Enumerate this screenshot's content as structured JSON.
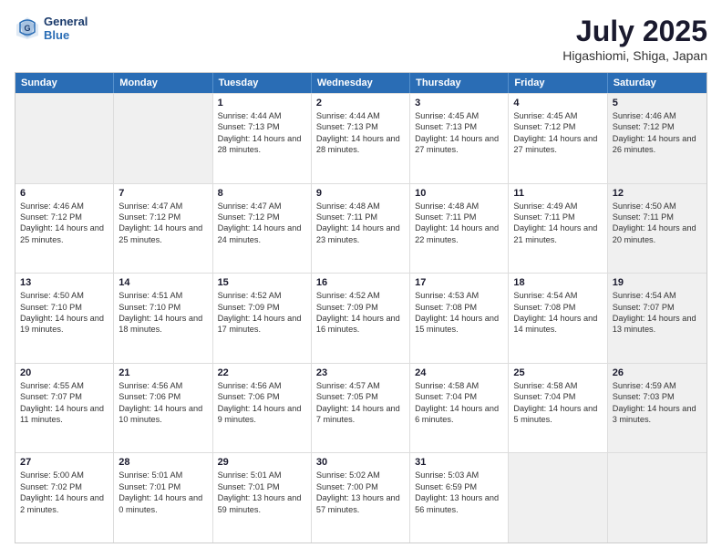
{
  "header": {
    "logo_line1": "General",
    "logo_line2": "Blue",
    "title": "July 2025",
    "subtitle": "Higashiomi, Shiga, Japan"
  },
  "days_of_week": [
    "Sunday",
    "Monday",
    "Tuesday",
    "Wednesday",
    "Thursday",
    "Friday",
    "Saturday"
  ],
  "weeks": [
    [
      {
        "day": "",
        "sunrise": "",
        "sunset": "",
        "daylight": "",
        "shaded": true
      },
      {
        "day": "",
        "sunrise": "",
        "sunset": "",
        "daylight": "",
        "shaded": true
      },
      {
        "day": "1",
        "sunrise": "Sunrise: 4:44 AM",
        "sunset": "Sunset: 7:13 PM",
        "daylight": "Daylight: 14 hours and 28 minutes."
      },
      {
        "day": "2",
        "sunrise": "Sunrise: 4:44 AM",
        "sunset": "Sunset: 7:13 PM",
        "daylight": "Daylight: 14 hours and 28 minutes."
      },
      {
        "day": "3",
        "sunrise": "Sunrise: 4:45 AM",
        "sunset": "Sunset: 7:13 PM",
        "daylight": "Daylight: 14 hours and 27 minutes."
      },
      {
        "day": "4",
        "sunrise": "Sunrise: 4:45 AM",
        "sunset": "Sunset: 7:12 PM",
        "daylight": "Daylight: 14 hours and 27 minutes."
      },
      {
        "day": "5",
        "sunrise": "Sunrise: 4:46 AM",
        "sunset": "Sunset: 7:12 PM",
        "daylight": "Daylight: 14 hours and 26 minutes.",
        "shaded": true
      }
    ],
    [
      {
        "day": "6",
        "sunrise": "Sunrise: 4:46 AM",
        "sunset": "Sunset: 7:12 PM",
        "daylight": "Daylight: 14 hours and 25 minutes."
      },
      {
        "day": "7",
        "sunrise": "Sunrise: 4:47 AM",
        "sunset": "Sunset: 7:12 PM",
        "daylight": "Daylight: 14 hours and 25 minutes."
      },
      {
        "day": "8",
        "sunrise": "Sunrise: 4:47 AM",
        "sunset": "Sunset: 7:12 PM",
        "daylight": "Daylight: 14 hours and 24 minutes."
      },
      {
        "day": "9",
        "sunrise": "Sunrise: 4:48 AM",
        "sunset": "Sunset: 7:11 PM",
        "daylight": "Daylight: 14 hours and 23 minutes."
      },
      {
        "day": "10",
        "sunrise": "Sunrise: 4:48 AM",
        "sunset": "Sunset: 7:11 PM",
        "daylight": "Daylight: 14 hours and 22 minutes."
      },
      {
        "day": "11",
        "sunrise": "Sunrise: 4:49 AM",
        "sunset": "Sunset: 7:11 PM",
        "daylight": "Daylight: 14 hours and 21 minutes."
      },
      {
        "day": "12",
        "sunrise": "Sunrise: 4:50 AM",
        "sunset": "Sunset: 7:11 PM",
        "daylight": "Daylight: 14 hours and 20 minutes.",
        "shaded": true
      }
    ],
    [
      {
        "day": "13",
        "sunrise": "Sunrise: 4:50 AM",
        "sunset": "Sunset: 7:10 PM",
        "daylight": "Daylight: 14 hours and 19 minutes."
      },
      {
        "day": "14",
        "sunrise": "Sunrise: 4:51 AM",
        "sunset": "Sunset: 7:10 PM",
        "daylight": "Daylight: 14 hours and 18 minutes."
      },
      {
        "day": "15",
        "sunrise": "Sunrise: 4:52 AM",
        "sunset": "Sunset: 7:09 PM",
        "daylight": "Daylight: 14 hours and 17 minutes."
      },
      {
        "day": "16",
        "sunrise": "Sunrise: 4:52 AM",
        "sunset": "Sunset: 7:09 PM",
        "daylight": "Daylight: 14 hours and 16 minutes."
      },
      {
        "day": "17",
        "sunrise": "Sunrise: 4:53 AM",
        "sunset": "Sunset: 7:08 PM",
        "daylight": "Daylight: 14 hours and 15 minutes."
      },
      {
        "day": "18",
        "sunrise": "Sunrise: 4:54 AM",
        "sunset": "Sunset: 7:08 PM",
        "daylight": "Daylight: 14 hours and 14 minutes."
      },
      {
        "day": "19",
        "sunrise": "Sunrise: 4:54 AM",
        "sunset": "Sunset: 7:07 PM",
        "daylight": "Daylight: 14 hours and 13 minutes.",
        "shaded": true
      }
    ],
    [
      {
        "day": "20",
        "sunrise": "Sunrise: 4:55 AM",
        "sunset": "Sunset: 7:07 PM",
        "daylight": "Daylight: 14 hours and 11 minutes."
      },
      {
        "day": "21",
        "sunrise": "Sunrise: 4:56 AM",
        "sunset": "Sunset: 7:06 PM",
        "daylight": "Daylight: 14 hours and 10 minutes."
      },
      {
        "day": "22",
        "sunrise": "Sunrise: 4:56 AM",
        "sunset": "Sunset: 7:06 PM",
        "daylight": "Daylight: 14 hours and 9 minutes."
      },
      {
        "day": "23",
        "sunrise": "Sunrise: 4:57 AM",
        "sunset": "Sunset: 7:05 PM",
        "daylight": "Daylight: 14 hours and 7 minutes."
      },
      {
        "day": "24",
        "sunrise": "Sunrise: 4:58 AM",
        "sunset": "Sunset: 7:04 PM",
        "daylight": "Daylight: 14 hours and 6 minutes."
      },
      {
        "day": "25",
        "sunrise": "Sunrise: 4:58 AM",
        "sunset": "Sunset: 7:04 PM",
        "daylight": "Daylight: 14 hours and 5 minutes."
      },
      {
        "day": "26",
        "sunrise": "Sunrise: 4:59 AM",
        "sunset": "Sunset: 7:03 PM",
        "daylight": "Daylight: 14 hours and 3 minutes.",
        "shaded": true
      }
    ],
    [
      {
        "day": "27",
        "sunrise": "Sunrise: 5:00 AM",
        "sunset": "Sunset: 7:02 PM",
        "daylight": "Daylight: 14 hours and 2 minutes."
      },
      {
        "day": "28",
        "sunrise": "Sunrise: 5:01 AM",
        "sunset": "Sunset: 7:01 PM",
        "daylight": "Daylight: 14 hours and 0 minutes."
      },
      {
        "day": "29",
        "sunrise": "Sunrise: 5:01 AM",
        "sunset": "Sunset: 7:01 PM",
        "daylight": "Daylight: 13 hours and 59 minutes."
      },
      {
        "day": "30",
        "sunrise": "Sunrise: 5:02 AM",
        "sunset": "Sunset: 7:00 PM",
        "daylight": "Daylight: 13 hours and 57 minutes."
      },
      {
        "day": "31",
        "sunrise": "Sunrise: 5:03 AM",
        "sunset": "Sunset: 6:59 PM",
        "daylight": "Daylight: 13 hours and 56 minutes."
      },
      {
        "day": "",
        "sunrise": "",
        "sunset": "",
        "daylight": "",
        "shaded": true
      },
      {
        "day": "",
        "sunrise": "",
        "sunset": "",
        "daylight": "",
        "shaded": true
      }
    ]
  ]
}
